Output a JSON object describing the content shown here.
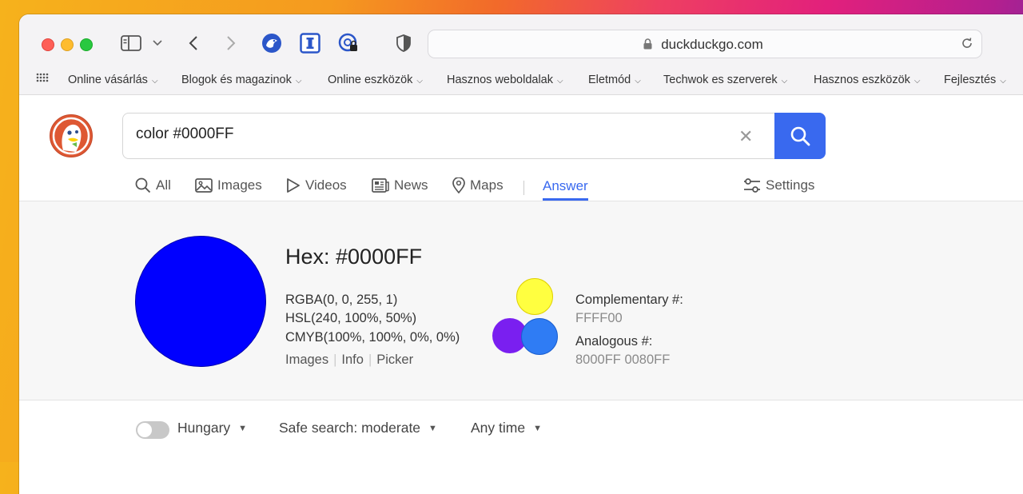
{
  "browser": {
    "url": "duckduckgo.com",
    "bookmarks": [
      "Online vásárlás",
      "Blogok és magazinok",
      "Online eszközök",
      "Hasznos weboldalak",
      "Eletmód",
      "Techwok es szerverek",
      "Hasznos eszközök",
      "Fejlesztés"
    ]
  },
  "search": {
    "query": "color #0000FF"
  },
  "tabs": {
    "all": "All",
    "images": "Images",
    "videos": "Videos",
    "news": "News",
    "maps": "Maps",
    "answer": "Answer",
    "settings": "Settings"
  },
  "answer": {
    "hex": "Hex: #0000FF",
    "rgba": "RGBA(0, 0, 255, 1)",
    "hsl": "HSL(240, 100%, 50%)",
    "cmyb": "CMYB(100%, 100%, 0%, 0%)",
    "links": {
      "images": "Images",
      "info": "Info",
      "picker": "Picker"
    },
    "complementary_label": "Complementary #:",
    "complementary_value": "FFFF00",
    "analogous_label": "Analogous #:",
    "analogous_value": "8000FF 0080FF",
    "colors": {
      "main": "#0000FF",
      "complementary": "#FFFF00",
      "analogous_1": "#8000FF",
      "analogous_2": "#0080FF"
    }
  },
  "filters": {
    "region": "Hungary",
    "safe_search": "Safe search: moderate",
    "time": "Any time"
  }
}
